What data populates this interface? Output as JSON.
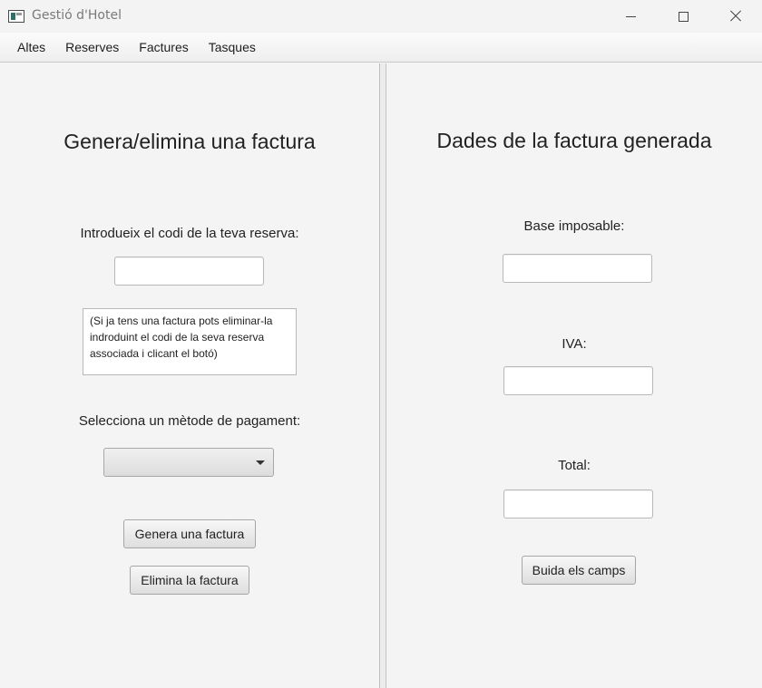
{
  "window": {
    "title": "Gestió d'Hotel",
    "controls": [
      "minimize-icon",
      "maximize-icon",
      "close-icon"
    ]
  },
  "menu": {
    "items": [
      "Altes",
      "Reserves",
      "Factures",
      "Tasques"
    ]
  },
  "left_panel": {
    "heading": "Genera/elimina una factura",
    "code_label": "Introdueix el codi de la teva reserva:",
    "code_value": "",
    "note_lines": [
      "(Si ja tens una factura pots eliminar-la",
      "indroduint el codi de la seva reserva",
      "associada i clicant el botó)"
    ],
    "payment_label": "Selecciona un mètode de pagament:",
    "payment_selected": "",
    "generate_button": "Genera una factura",
    "delete_button": "Elimina la factura"
  },
  "right_panel": {
    "heading": "Dades de la factura generada",
    "base_label": "Base imposable:",
    "base_value": "",
    "iva_label": "IVA:",
    "iva_value": "",
    "total_label": "Total:",
    "total_value": "",
    "clear_button": "Buida els camps"
  }
}
